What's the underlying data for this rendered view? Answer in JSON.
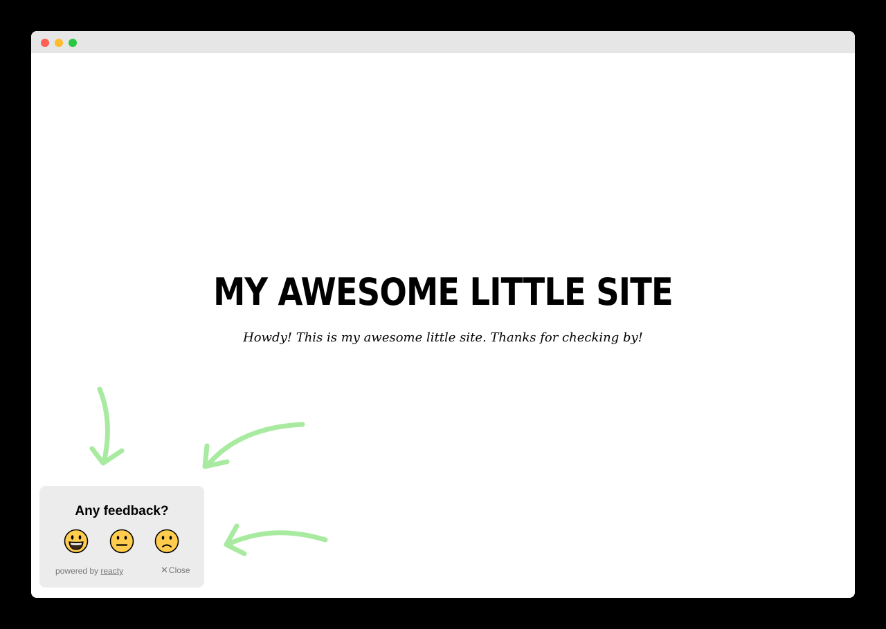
{
  "page": {
    "title": "My awesome little site",
    "subtitle": "Howdy! This is my awesome little site. Thanks for checking by!"
  },
  "widget": {
    "heading": "Any feedback?",
    "reactions": [
      {
        "icon": "grinning-face-icon",
        "label": "happy"
      },
      {
        "icon": "neutral-face-icon",
        "label": "neutral"
      },
      {
        "icon": "slightly-frowning-face-icon",
        "label": "sad"
      }
    ],
    "powered_prefix": "powered by",
    "powered_link": "reacty",
    "close_glyph": "✕",
    "close_label": "Close"
  },
  "colors": {
    "window_bg": "#ffffff",
    "titlebar_bg": "#e6e6e6",
    "widget_bg": "#ececec",
    "arrow": "#a8eba0",
    "emoji_face": "#ffcc4d",
    "traffic_red": "#ff5f57",
    "traffic_yellow": "#febc2e",
    "traffic_green": "#28c840"
  }
}
